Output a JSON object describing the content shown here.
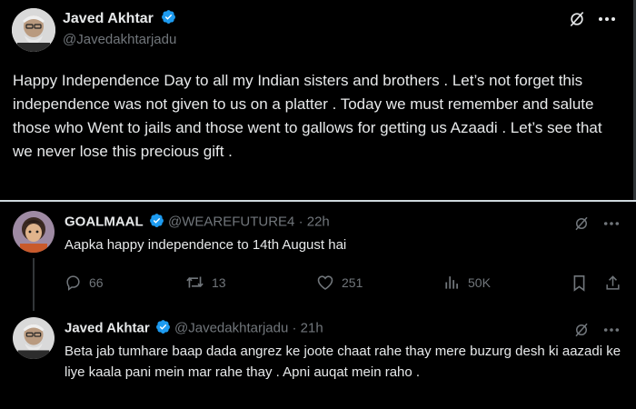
{
  "main_tweet": {
    "author_name": "Javed Akhtar",
    "handle": "@Javedakhtarjadu",
    "text": "Happy Independence Day  to all my Indian sisters and brothers  . Let’s not forget this independence was not given to us on a platter . Today we must remember and salute those who Went to jails and those went to gallows for getting us Azaadi . Let’s see that we never lose this precious gift .",
    "icons": [
      "grok-icon",
      "more-icon"
    ]
  },
  "reply_1": {
    "author_name": "GOALMAAL",
    "handle": "@WEAREFUTURE4",
    "separator": "·",
    "time": "22h",
    "text": "Aapka happy independence to 14th August hai",
    "stats": {
      "replies": "66",
      "reposts": "13",
      "likes": "251",
      "views": "50K"
    }
  },
  "reply_2": {
    "author_name": "Javed Akhtar",
    "handle": "@Javedakhtarjadu",
    "separator": "·",
    "time": "21h",
    "text": "Beta jab tumhare baap dada angrez ke joote chaat rahe thay mere buzurg desh ki aazadi ke liye kaala pani mein mar rahe thay . Apni auqat mein raho ."
  },
  "colors": {
    "background": "#000000",
    "text": "#e7e9ea",
    "muted": "#71767b",
    "verified": "#1d9bf0",
    "divider": "#2f3336"
  }
}
